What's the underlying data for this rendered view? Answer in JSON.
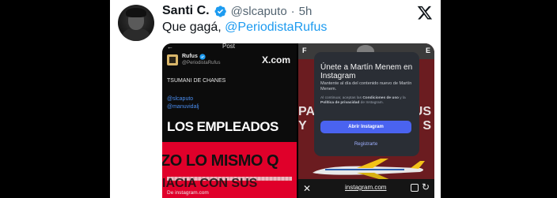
{
  "tweet": {
    "author_name": "Santi C.",
    "handle": "@slcaputo",
    "separator": "·",
    "time": "5h",
    "text_prefix": "Que gagá, ",
    "text_mention": "@PeriodistaRufus"
  },
  "colors": {
    "mention_blue": "#1d9bf0",
    "name_text": "#0f1419",
    "meta_text": "#536471",
    "verified_blue": "#1d9bf0",
    "left_red": "#e0002a",
    "modal_button": "#4a63f0"
  },
  "icons": {
    "verified": "verified-badge-icon",
    "platform_logo": "x-logo-icon",
    "close": "close-icon",
    "reload": "reload-icon"
  },
  "media_left": {
    "top_label": "Post",
    "back_glyph": "←",
    "account_name": "Rufus",
    "account_handle": "@PeriodistaRufus",
    "brand": "X.com",
    "line1": "TSUMANI DE CHANES",
    "mention1": "@slcaputo",
    "mention2": "@manuvidalj",
    "caption_big": "LOS EMPLEADOS",
    "caption_red": "ZO LO MISMO Q",
    "caption_cut": "IACIA CON SUS",
    "footer": "De instagram.com"
  },
  "media_right": {
    "corner_left": "F",
    "corner_right": "E",
    "bg_left1": "PA",
    "bg_left2": "Y",
    "bg_right1": "US",
    "bg_right2": "S",
    "modal_title": "Únete a Martín Menem en Instagram",
    "modal_desc": "Mantente al día del contenido nuevo de Martín Menem.",
    "modal_terms_prefix": "Al continuar, aceptas las ",
    "modal_terms_link1": "Condiciones de uso",
    "modal_terms_mid": " y la ",
    "modal_terms_link2": "Política de privacidad",
    "modal_terms_suffix": " de Instagram.",
    "open_button": "Abrir Instagram",
    "register_link": "Registrarte",
    "url": "instagram.com",
    "close_glyph": "✕",
    "reload_glyph": "↻"
  }
}
